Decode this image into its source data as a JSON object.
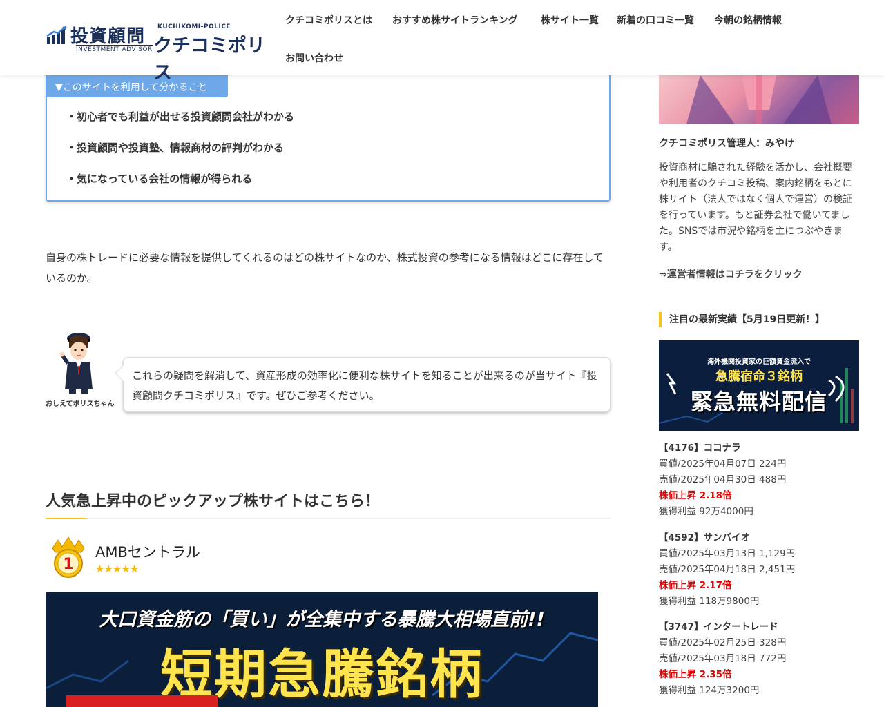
{
  "header": {
    "logo": {
      "main": "投資顧問",
      "sub": "INVESTMENT ADVISOR",
      "police_en": "KUCHIKOMI-POLICE",
      "police_jp": "クチコミポリス"
    },
    "nav": [
      {
        "label": "クチコミポリスとは"
      },
      {
        "label": "おすすめ株サイトランキング"
      },
      {
        "label": "株サイト一覧"
      },
      {
        "label": "新着の口コミ一覧"
      },
      {
        "label": "今朝の銘柄情報"
      },
      {
        "label": "お問い合わせ"
      }
    ]
  },
  "info_box": {
    "tab": "▼このサイトを利用して分かること",
    "items": [
      "・初心者でも利益が出せる投資顧問会社がわかる",
      "・投資顧問や投資塾、情報商材の評判がわかる",
      "・気になっている会社の情報が得られる"
    ]
  },
  "intro": "自身の株トレードに必要な情報を提供してくれるのはどの株サイトなのか、株式投資の参考になる情報はどこに存在しているのか。",
  "speech": {
    "avatar_label": "おしえてポリスちゃん",
    "text": "これらの疑問を解消して、資産形成の効率化に便利な株サイトを知ることが出来るのが当サイト『投資顧問クチコミポリス』です。ぜひご参考ください。"
  },
  "section": {
    "title": "人気急上昇中のピックアップ株サイトはこちら！"
  },
  "rank1": {
    "rank": "1",
    "name": "AMBセントラル",
    "stars": "★★★★★",
    "rating": 5,
    "banner_line1": "大口資金筋の「買い」が全集中する暴騰大相場直前!!",
    "banner_line2": "短期急騰銘柄"
  },
  "sidebar": {
    "admin": "クチコミポリス管理人：みやけ",
    "desc": "投資商材に騙された経験を活かし、会社概要や利用者のクチコミ投稿、案内銘柄をもとに株サイト（法人ではなく個人で運営）の検証を行っています。もと証券会社で働いてました。SNSでは市況や銘柄を主につぶやきます。",
    "link": "⇒運営者情報はコチラをクリック",
    "heading": "注目の最新実績【5月19日更新！】",
    "banner": {
      "line1": "海外機関投資家の巨額資金流入で",
      "line2": "急騰宿命３銘柄",
      "line3": "緊急無料配信"
    },
    "stocks": [
      {
        "name": "【4176】ココナラ",
        "buy": "買値/2025年04月07日 224円",
        "sell": "売値/2025年04月30日 488円",
        "up": "株価上昇 2.18倍",
        "profit": "獲得利益 92万4000円"
      },
      {
        "name": "【4592】サンバイオ",
        "buy": "買値/2025年03月13日 1,129円",
        "sell": "売値/2025年04月18日 2,451円",
        "up": "株価上昇 2.17倍",
        "profit": "獲得利益 118万9800円"
      },
      {
        "name": "【3747】インタートレード",
        "buy": "買値/2025年02月25日 328円",
        "sell": "売値/2025年03月18日 772円",
        "up": "株価上昇 2.35倍",
        "profit": "獲得利益 124万3200円"
      }
    ]
  },
  "colors": {
    "navy": "#1b2f5c",
    "accent_blue": "#6ea8e8",
    "accent_yellow": "#f5c518",
    "up_red": "#e00000"
  }
}
